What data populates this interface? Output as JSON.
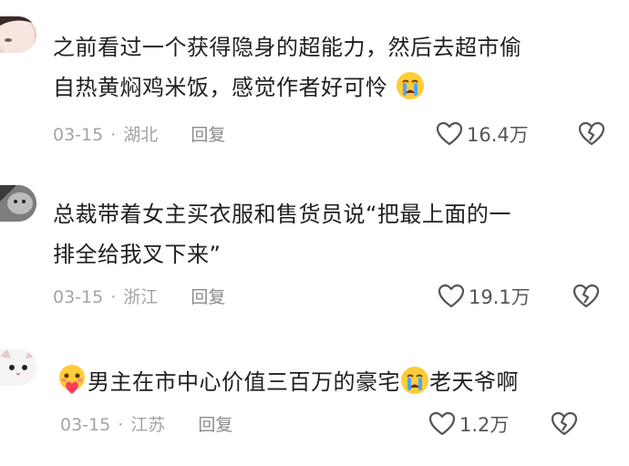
{
  "comments": [
    {
      "text_line1": "之前看过一个获得隐身的超能力，然后去超市偷",
      "text_line2": "自热黄焖鸡米饭，感觉作者好可怜",
      "emoji_end": "crying-face",
      "date": "03-15",
      "location": "湖北",
      "reply_label": "回复",
      "like_count": "16.4万"
    },
    {
      "text_line1": "总裁带着女主买衣服和售货员说“把最上面的一",
      "text_line2": "排全给我叉下来”",
      "date": "03-15",
      "location": "浙江",
      "reply_label": "回复",
      "like_count": "19.1万"
    },
    {
      "emoji_start": "face-holding-heart",
      "text_part1": "男主在市中心价值三百万的豪宅",
      "emoji_mid": "crying-face",
      "text_part2": "老天爷啊",
      "date": "03-15",
      "location": "江苏",
      "reply_label": "回复",
      "like_count": "1.2万"
    }
  ],
  "colors": {
    "text": "#1f1f1f",
    "meta": "#a3a3a3",
    "icon": "#555555"
  },
  "icons": [
    "heart-outline-icon",
    "broken-heart-icon"
  ]
}
